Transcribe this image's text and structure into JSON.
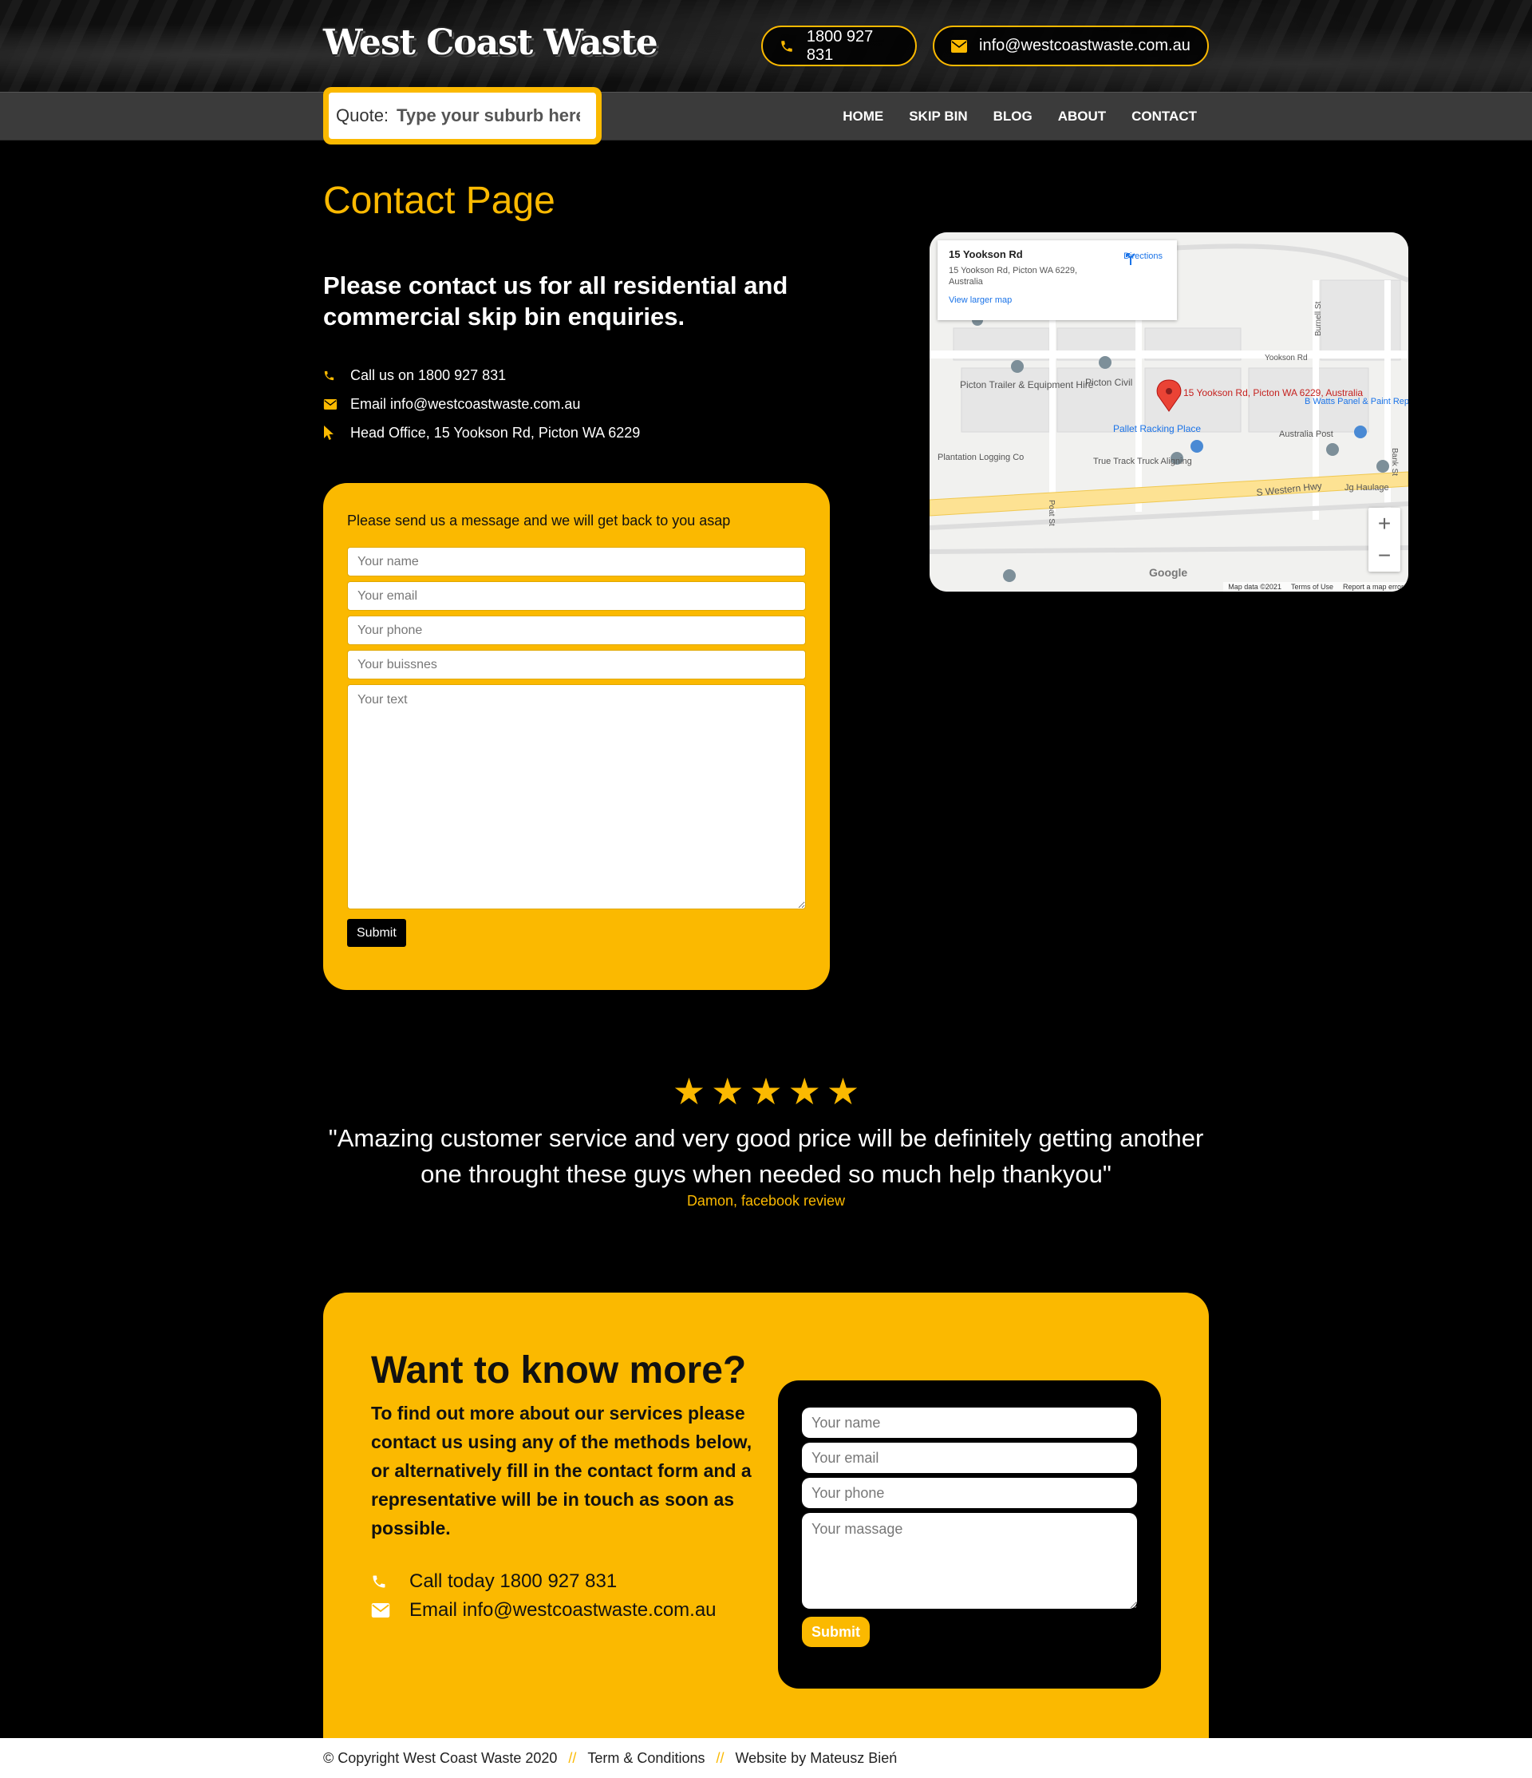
{
  "colors": {
    "accent": "#fbb900",
    "background": "#000000",
    "nav": "#3b3b3b"
  },
  "header": {
    "logo": "West Coast Waste",
    "phone": "1800 927 831",
    "email": "info@westcoastwaste.com.au",
    "phone_icon": "phone-icon",
    "email_icon": "envelope-icon"
  },
  "quote": {
    "label": "Quote:",
    "placeholder": "Type your suburb here"
  },
  "nav": {
    "items": [
      "HOME",
      "SKIP BIN",
      "BLOG",
      "ABOUT",
      "CONTACT"
    ]
  },
  "contact": {
    "title": "Contact Page",
    "lead": "Please contact us for all residential and commercial skip bin enquiries.",
    "info": [
      {
        "icon": "phone-icon",
        "text": "Call us on 1800 927 831"
      },
      {
        "icon": "envelope-icon",
        "text": "Email info@westcoastwaste.com.au"
      },
      {
        "icon": "pointer-icon",
        "text": "Head Office, 15 Yookson Rd, Picton WA 6229"
      }
    ]
  },
  "message_form": {
    "hint": "Please send us a message and we will get back to you asap",
    "name_placeholder": "Your name",
    "email_placeholder": "Your email",
    "phone_placeholder": "Your phone",
    "business_placeholder": "Your buissnes",
    "text_placeholder": "Your text",
    "submit": "Submit"
  },
  "map": {
    "card_title": "15 Yookson Rd",
    "card_address": "15 Yookson Rd, Picton WA 6229, Australia",
    "card_link": "View larger map",
    "directions": "Directions",
    "pin_label": "15 Yookson Rd, Picton WA 6229, Australia",
    "labels": [
      "Picton Trailer & Equipment Hire",
      "Picton Civil",
      "Pallet Racking Place",
      "B Watts Panel & Paint Repairs",
      "Australia Post",
      "Plantation Logging Co",
      "True Track Truck Aligning",
      "S Western Hwy",
      "Jg Haulage",
      "Yookson Rd",
      "Poat St",
      "Burnell St",
      "Bank St"
    ],
    "zoom_in": "+",
    "zoom_out": "−",
    "google": "Google",
    "footer": [
      "Map data ©2021",
      "Terms of Use",
      "Report a map error"
    ]
  },
  "review": {
    "stars": 5,
    "text": "\"Amazing customer service and very good price will be definitely getting another one throught these guys when needed so much help thankyou\"",
    "author": "Damon, facebook review"
  },
  "more": {
    "title": "Want to know more?",
    "description": "To find out more about our services please contact us using any of the methods below, or alternatively fill in the contact form and a representative will be in touch as soon as possible.",
    "call": "Call today 1800 927 831",
    "email": "Email info@westcoastwaste.com.au",
    "form": {
      "name_placeholder": "Your name",
      "email_placeholder": "Your email",
      "phone_placeholder": "Your phone",
      "message_placeholder": "Your massage",
      "submit": "Submit"
    }
  },
  "footer": {
    "copyright": "© Copyright West Coast Waste 2020",
    "separator": "//",
    "terms": "Term & Conditions",
    "credit": "Website by Mateusz Bień"
  }
}
